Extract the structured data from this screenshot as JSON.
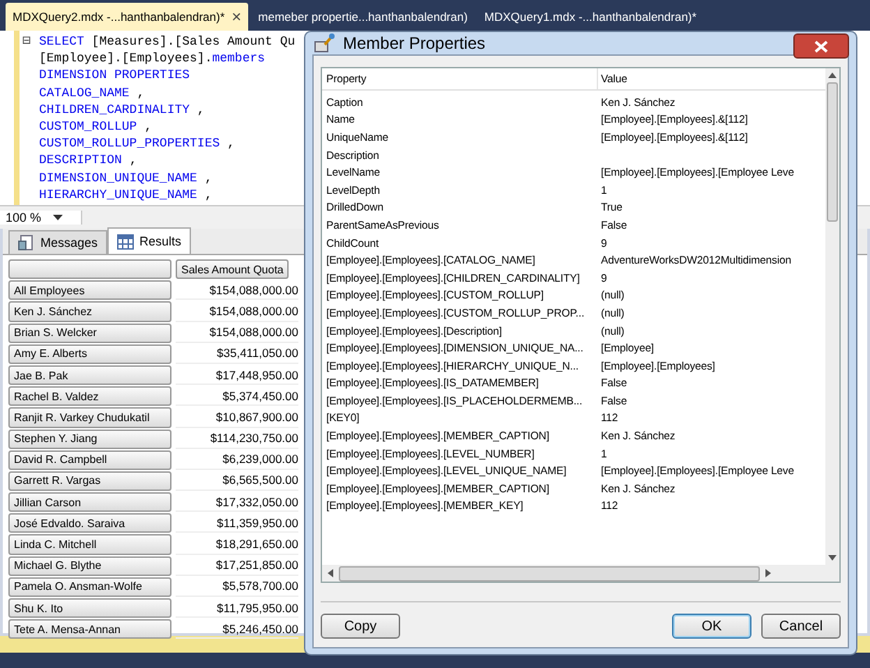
{
  "document_tabs": [
    {
      "label": "MDXQuery2.mdx -...hanthanbalendran)*",
      "selected": true,
      "close": "×"
    },
    {
      "label": "memeber propertie...hanthanbalendran)",
      "selected": false
    },
    {
      "label": "MDXQuery1.mdx -...hanthanbalendran)*",
      "selected": false
    }
  ],
  "editor": {
    "collapse": "⊟",
    "lines": [
      [
        {
          "text": "SELECT",
          "kind": "keyword"
        },
        {
          "text": " [Measures].[Sales Amount Qu",
          "kind": "plain"
        }
      ],
      [
        {
          "text": "[Employee].[Employees].",
          "kind": "plain"
        },
        {
          "text": "members",
          "kind": "keyword"
        }
      ],
      [
        {
          "text": "DIMENSION PROPERTIES",
          "kind": "keyword"
        }
      ],
      [
        {
          "text": "CATALOG_NAME",
          "kind": "keyword"
        },
        {
          "text": " ,",
          "kind": "plain"
        }
      ],
      [
        {
          "text": "CHILDREN_CARDINALITY",
          "kind": "keyword"
        },
        {
          "text": " ,",
          "kind": "plain"
        }
      ],
      [
        {
          "text": "CUSTOM_ROLLUP",
          "kind": "keyword"
        },
        {
          "text": " ,",
          "kind": "plain"
        }
      ],
      [
        {
          "text": "CUSTOM_ROLLUP_PROPERTIES",
          "kind": "keyword"
        },
        {
          "text": " ,",
          "kind": "plain"
        }
      ],
      [
        {
          "text": "DESCRIPTION",
          "kind": "keyword"
        },
        {
          "text": " ,",
          "kind": "plain"
        }
      ],
      [
        {
          "text": "DIMENSION_UNIQUE_NAME",
          "kind": "keyword"
        },
        {
          "text": " ,",
          "kind": "plain"
        }
      ],
      [
        {
          "text": "HIERARCHY_UNIQUE_NAME",
          "kind": "keyword"
        },
        {
          "text": " ,",
          "kind": "plain"
        }
      ]
    ],
    "zoom": "100 %"
  },
  "result_tabs": [
    {
      "label": "Messages",
      "selected": false
    },
    {
      "label": "Results",
      "selected": true
    }
  ],
  "results": {
    "columns": [
      "Sales Amount Quota"
    ],
    "rows": [
      {
        "member": "All Employees",
        "value": "$154,088,000.00"
      },
      {
        "member": "Ken J. Sánchez",
        "value": "$154,088,000.00"
      },
      {
        "member": "Brian S. Welcker",
        "value": "$154,088,000.00"
      },
      {
        "member": "Amy E. Alberts",
        "value": "$35,411,050.00"
      },
      {
        "member": "Jae B. Pak",
        "value": "$17,448,950.00"
      },
      {
        "member": "Rachel B. Valdez",
        "value": "$5,374,450.00"
      },
      {
        "member": "Ranjit R. Varkey Chudukatil",
        "value": "$10,867,900.00"
      },
      {
        "member": "Stephen Y. Jiang",
        "value": "$114,230,750.00"
      },
      {
        "member": "David R. Campbell",
        "value": "$6,239,000.00"
      },
      {
        "member": "Garrett R. Vargas",
        "value": "$6,565,500.00"
      },
      {
        "member": "Jillian Carson",
        "value": "$17,332,050.00"
      },
      {
        "member": "José Edvaldo. Saraiva",
        "value": "$11,359,950.00"
      },
      {
        "member": "Linda C. Mitchell",
        "value": "$18,291,650.00"
      },
      {
        "member": "Michael G. Blythe",
        "value": "$17,251,850.00"
      },
      {
        "member": "Pamela O. Ansman-Wolfe",
        "value": "$5,578,700.00"
      },
      {
        "member": "Shu K. Ito",
        "value": "$11,795,950.00"
      },
      {
        "member": "Tete A. Mensa-Annan",
        "value": "$5,246,450.00"
      }
    ]
  },
  "dialog": {
    "title": "Member Properties",
    "columns": [
      "Property",
      "Value"
    ],
    "rows": [
      [
        "Caption",
        "Ken J. Sánchez"
      ],
      [
        "Name",
        "[Employee].[Employees].&[112]"
      ],
      [
        "UniqueName",
        "[Employee].[Employees].&[112]"
      ],
      [
        "Description",
        ""
      ],
      [
        "LevelName",
        "[Employee].[Employees].[Employee Leve"
      ],
      [
        "LevelDepth",
        "1"
      ],
      [
        "DrilledDown",
        "True"
      ],
      [
        "ParentSameAsPrevious",
        "False"
      ],
      [
        "ChildCount",
        "9"
      ],
      [
        "[Employee].[Employees].[CATALOG_NAME]",
        "AdventureWorksDW2012Multidimension"
      ],
      [
        "[Employee].[Employees].[CHILDREN_CARDINALITY]",
        "9"
      ],
      [
        "[Employee].[Employees].[CUSTOM_ROLLUP]",
        "(null)"
      ],
      [
        "[Employee].[Employees].[CUSTOM_ROLLUP_PROP...",
        "(null)"
      ],
      [
        "[Employee].[Employees].[Description]",
        "(null)"
      ],
      [
        "[Employee].[Employees].[DIMENSION_UNIQUE_NA...",
        "[Employee]"
      ],
      [
        "[Employee].[Employees].[HIERARCHY_UNIQUE_N...",
        "[Employee].[Employees]"
      ],
      [
        "[Employee].[Employees].[IS_DATAMEMBER]",
        "False"
      ],
      [
        "[Employee].[Employees].[IS_PLACEHOLDERMEMB...",
        "False"
      ],
      [
        "[KEY0]",
        "112"
      ],
      [
        "[Employee].[Employees].[MEMBER_CAPTION]",
        "Ken J. Sánchez"
      ],
      [
        "[Employee].[Employees].[LEVEL_NUMBER]",
        "1"
      ],
      [
        "[Employee].[Employees].[LEVEL_UNIQUE_NAME]",
        "[Employee].[Employees].[Employee Leve"
      ],
      [
        "[Employee].[Employees].[MEMBER_CAPTION]",
        "Ken J. Sánchez"
      ],
      [
        "[Employee].[Employees].[MEMBER_KEY]",
        "112"
      ]
    ],
    "buttons": [
      {
        "label": "Copy",
        "default": false
      },
      {
        "label": "OK",
        "default": true
      },
      {
        "label": "Cancel",
        "default": false
      }
    ]
  }
}
